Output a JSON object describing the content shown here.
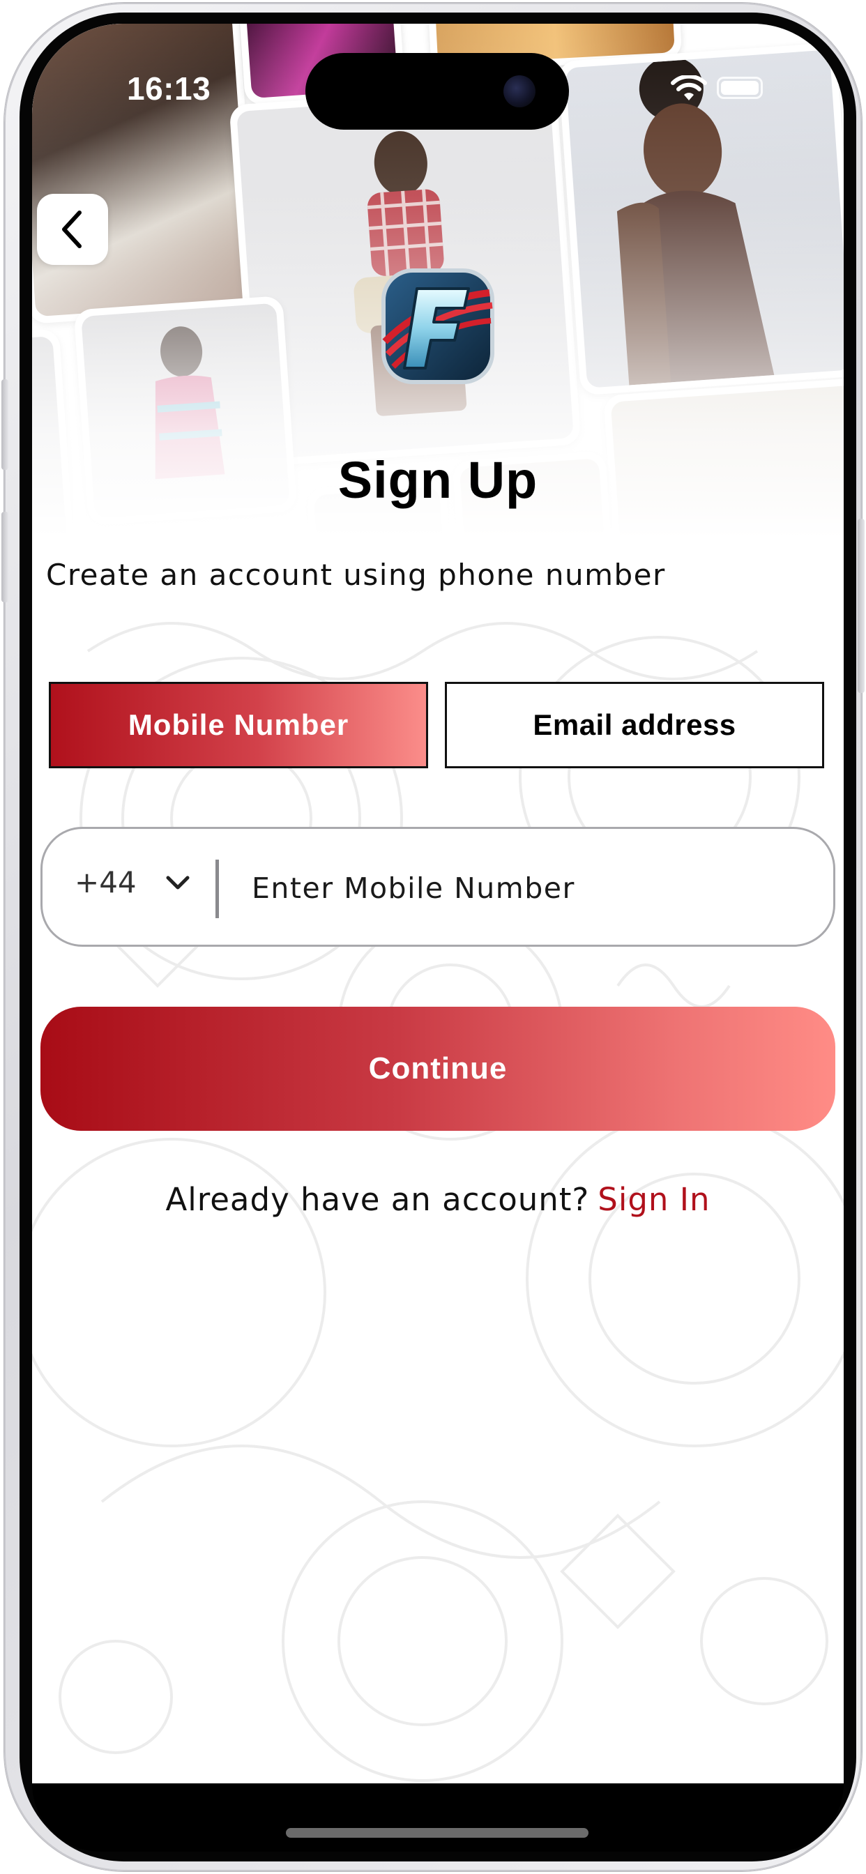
{
  "status_bar": {
    "time": "16:13"
  },
  "header": {
    "back_icon": "chevron-left-icon",
    "logo_letter": "F",
    "title": "Sign Up",
    "subtitle": "Create an account using phone number"
  },
  "tabs": [
    {
      "label": "Mobile Number",
      "selected": true
    },
    {
      "label": "Email address",
      "selected": false
    }
  ],
  "phone": {
    "country_code": "+44",
    "placeholder": "Enter Mobile Number",
    "value": ""
  },
  "continue_label": "Continue",
  "footer": {
    "prompt": "Already have an account?",
    "link": "Sign In"
  },
  "colors": {
    "accent": "#b0101b",
    "gradient_start": "#a80c16",
    "gradient_end": "#ff8c86"
  }
}
